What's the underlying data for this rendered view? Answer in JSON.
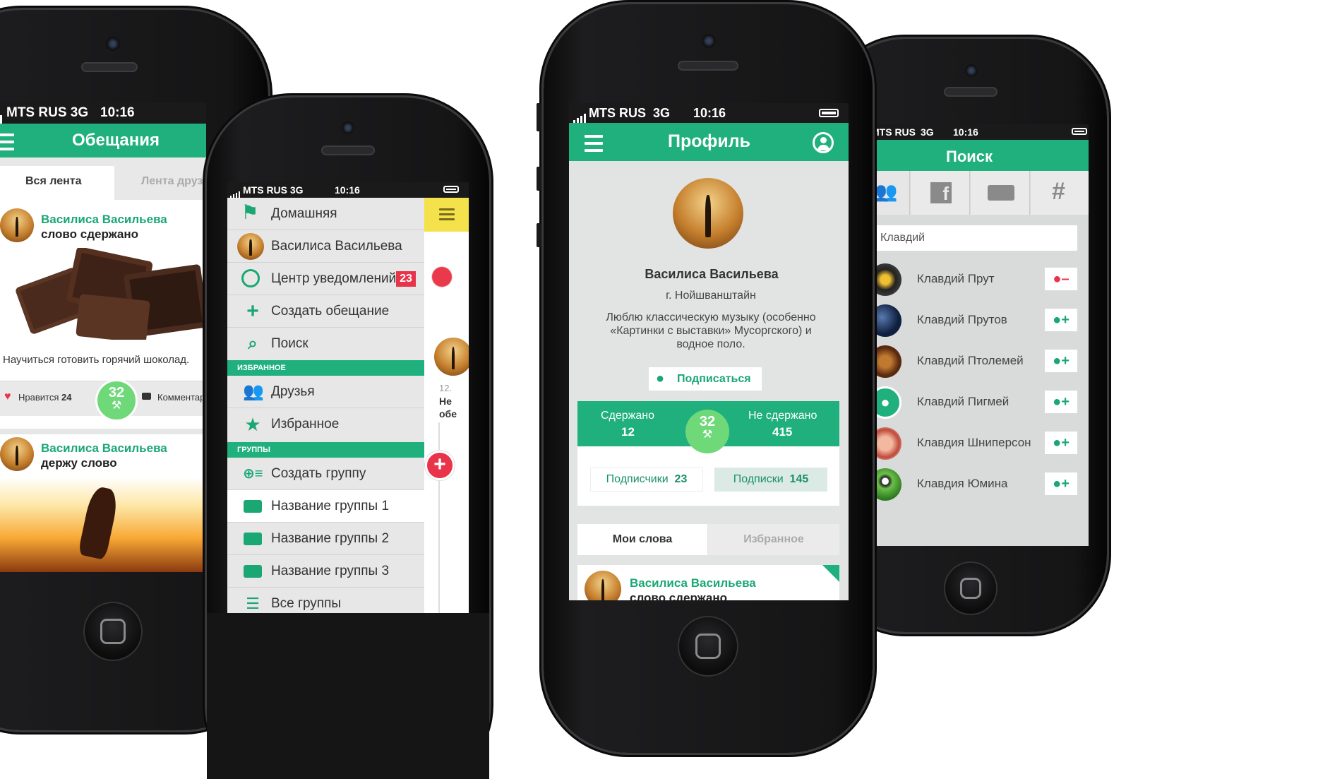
{
  "status_bar": {
    "carrier": "MTS RUS",
    "network": "3G",
    "time": "10:16"
  },
  "feed": {
    "title": "Обещания",
    "tabs": [
      {
        "label": "Вся лента"
      },
      {
        "label": "Лента друзе"
      }
    ],
    "posts": [
      {
        "author": "Василиса Васильева",
        "status": "слово сдержано",
        "text": "Научиться готовить горячий шоколад.",
        "likes_label": "Нравится",
        "likes_count": "24",
        "comments_label": "Комментар",
        "badge": "32"
      },
      {
        "author": "Василиса Васильева",
        "status": "держу слово"
      }
    ]
  },
  "menu": {
    "items": [
      {
        "label": "Домашняя",
        "icon": "home-icon"
      },
      {
        "label": "Василиса Васильева",
        "icon": "avatar"
      },
      {
        "label": "Центр уведомлений",
        "icon": "clock-icon",
        "badge": "23"
      },
      {
        "label": "Создать обещание",
        "icon": "plus-icon"
      },
      {
        "label": "Поиск",
        "icon": "search-icon"
      }
    ],
    "favorites_header": "ИЗБРАННОЕ",
    "favorites": [
      {
        "label": "Друзья",
        "icon": "friends-icon"
      },
      {
        "label": "Избранное",
        "icon": "star-icon"
      }
    ],
    "groups_header": "ГРУППЫ",
    "groups": [
      {
        "label": "Создать группу",
        "icon": "create-group-icon"
      },
      {
        "label": "Название группы 1",
        "icon": "chat-icon"
      },
      {
        "label": "Название группы 2",
        "icon": "chat-icon"
      },
      {
        "label": "Название группы 3",
        "icon": "chat-icon"
      },
      {
        "label": "Все группы",
        "icon": "list-icon"
      }
    ],
    "peek": {
      "date": "12.",
      "line1": "Не",
      "line2": "обе"
    }
  },
  "profile": {
    "title": "Профиль",
    "name": "Василиса Васильева",
    "city": "г. Нойшванштайн",
    "bio": "Люблю классическую музыку (особенно «Картинки с выставки» Мусоргского) и водное поло.",
    "subscribe_label": "Подписаться",
    "kept_label": "Сдержано",
    "kept_count": "12",
    "broken_label": "Не сдержано",
    "broken_count": "415",
    "badge": "32",
    "followers_label": "Подписчики",
    "followers_count": "23",
    "following_label": "Подписки",
    "following_count": "145",
    "tabs": [
      {
        "label": "Мои слова"
      },
      {
        "label": "Избранное"
      }
    ],
    "post": {
      "author": "Василиса Васильева",
      "status": "слово сдержано"
    }
  },
  "search": {
    "title": "Поиск",
    "carrier": "MTS RUS",
    "query": "Клавдий",
    "tabs": [
      "friends-icon",
      "facebook-icon",
      "chat-icon",
      "hashtag-icon"
    ],
    "hashtag_glyph": "#",
    "results": [
      {
        "name": "Клавдий Прут",
        "action": "remove",
        "symbol": "–"
      },
      {
        "name": "Клавдий Прутов",
        "action": "add",
        "symbol": "+"
      },
      {
        "name": "Клавдий Птолемей",
        "action": "add",
        "symbol": "+"
      },
      {
        "name": "Клавдий Пигмей",
        "action": "add",
        "symbol": "+"
      },
      {
        "name": "Клавдия Шниперсон",
        "action": "add",
        "symbol": "+"
      },
      {
        "name": "Клавдия Юмина",
        "action": "add",
        "symbol": "+"
      }
    ]
  },
  "colors": {
    "brand": "#1fb07e",
    "danger": "#e8334a",
    "highlight": "#f3e24b"
  }
}
